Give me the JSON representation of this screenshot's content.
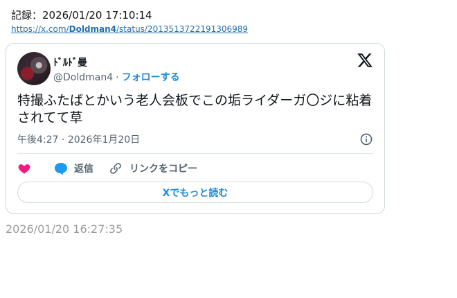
{
  "record": {
    "text": "記録：2026/01/20 17:10:14"
  },
  "source_link": {
    "prefix": "https://x.com/",
    "user": "Doldman4",
    "suffix": "/status/2013513722191306989"
  },
  "tweet": {
    "display_name": "ﾄﾞﾙﾄﾞ曼",
    "handle": "@Doldman4",
    "separator": "·",
    "follow_label": "フォローする",
    "text": "特撮ふたばとかいう老人会板でこの垢ライダーガ〇ジに粘着されてて草",
    "time": "午後4:27",
    "date_separator": "·",
    "date": "2026年1月20日",
    "actions": {
      "reply_label": "返信",
      "copy_link_label": "リンクをコピー"
    },
    "read_more_label": "Xでもっと読む"
  },
  "timestamp": "2026/01/20 16:27:35",
  "colors": {
    "accent": "#1d8adb",
    "like": "#f91880",
    "text": "#0f1419",
    "muted": "#536471"
  },
  "icons": [
    "x-logo-icon",
    "info-icon",
    "heart-icon",
    "reply-bubble-icon",
    "link-icon"
  ]
}
